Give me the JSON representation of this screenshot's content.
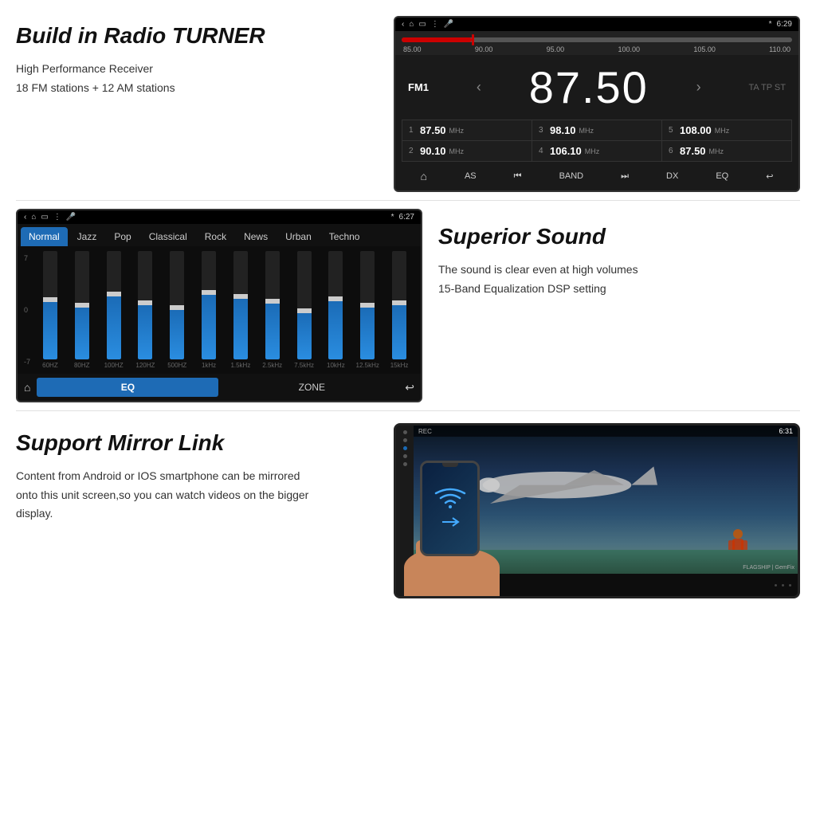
{
  "radio": {
    "section_title": "Build in Radio TURNER",
    "desc_line1": "High Performance Receiver",
    "desc_line2": "18 FM stations + 12 AM stations",
    "status_time": "6:29",
    "bluetooth": "BT",
    "band": "FM1",
    "freq": "87.50",
    "freq_labels": [
      "85.00",
      "90.00",
      "95.00",
      "100.00",
      "105.00",
      "110.00"
    ],
    "ta_tp_st": "TA TP ST",
    "presets": [
      {
        "num": "1",
        "freq": "87.50",
        "unit": "MHz"
      },
      {
        "num": "3",
        "freq": "98.10",
        "unit": "MHz"
      },
      {
        "num": "5",
        "freq": "108.00",
        "unit": "MHz"
      },
      {
        "num": "2",
        "freq": "90.10",
        "unit": "MHz"
      },
      {
        "num": "4",
        "freq": "106.10",
        "unit": "MHz"
      },
      {
        "num": "6",
        "freq": "87.50",
        "unit": "MHz"
      }
    ],
    "controls": [
      "AS",
      "⏮",
      "BAND",
      "⏭",
      "DX",
      "EQ",
      "↩"
    ]
  },
  "equalizer": {
    "status_time": "6:27",
    "bluetooth": "BT",
    "modes": [
      "Normal",
      "Jazz",
      "Pop",
      "Classical",
      "Rock",
      "News",
      "Urban",
      "Techno"
    ],
    "active_mode": "Normal",
    "levels_label": [
      "7",
      "0",
      "-7"
    ],
    "bands": [
      {
        "freq": "60HZ",
        "height": 55,
        "pos": 45
      },
      {
        "freq": "80HZ",
        "height": 50,
        "pos": 48
      },
      {
        "freq": "100HZ",
        "height": 60,
        "pos": 40
      },
      {
        "freq": "120HZ",
        "height": 52,
        "pos": 46
      },
      {
        "freq": "500HZ",
        "height": 48,
        "pos": 50
      },
      {
        "freq": "1kHz",
        "height": 62,
        "pos": 37
      },
      {
        "freq": "1.5kHz",
        "height": 58,
        "pos": 41
      },
      {
        "freq": "2.5kHz",
        "height": 54,
        "pos": 44
      },
      {
        "freq": "7.5kHz",
        "height": 45,
        "pos": 53
      },
      {
        "freq": "10kHz",
        "height": 56,
        "pos": 43
      },
      {
        "freq": "12.5kHz",
        "height": 50,
        "pos": 48
      },
      {
        "freq": "15kHz",
        "height": 52,
        "pos": 46
      }
    ],
    "footer_eq": "EQ",
    "footer_zone": "ZONE"
  },
  "superior_sound": {
    "title": "Superior Sound",
    "desc_line1": "The sound is clear even at high volumes",
    "desc_line2": "15-Band Equalization DSP setting"
  },
  "mirror_link": {
    "title": "Support Mirror Link",
    "desc": "Content from Android or IOS smartphone can be mirrored onto this unit screen,so you can watch videos on the  bigger display.",
    "screen_time": "6:31",
    "brand1": "FLAGSHIP",
    "brand2": "GemFix"
  }
}
